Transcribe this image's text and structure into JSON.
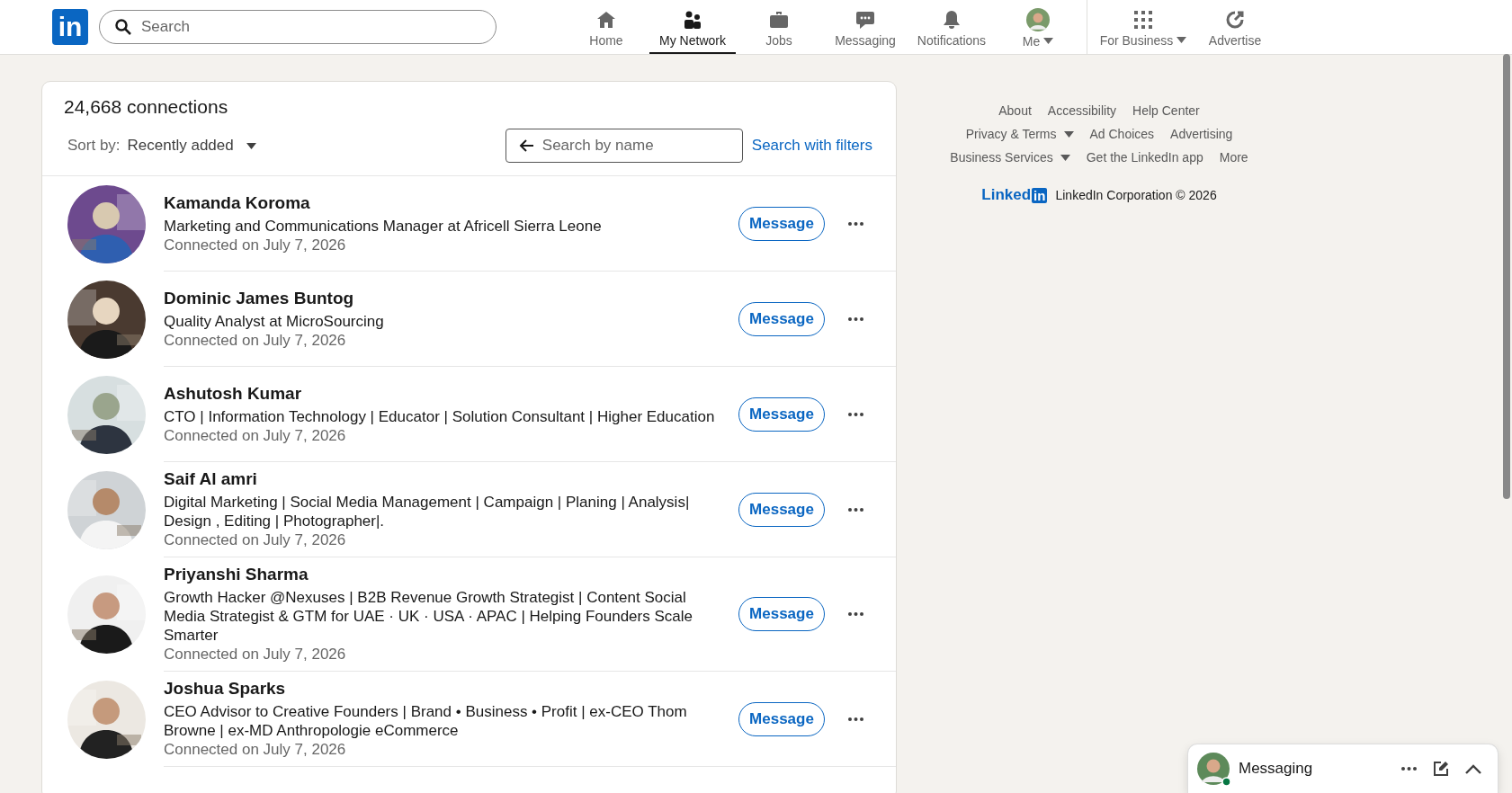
{
  "nav": {
    "logo": "in",
    "search": {
      "placeholder": "Search"
    },
    "items": [
      {
        "label": "Home",
        "kind": "home",
        "selected": false,
        "caret": false
      },
      {
        "label": "My Network",
        "kind": "network",
        "selected": true,
        "caret": false
      },
      {
        "label": "Jobs",
        "kind": "jobs",
        "selected": false,
        "caret": false
      },
      {
        "label": "Messaging",
        "kind": "messaging",
        "selected": false,
        "caret": false
      },
      {
        "label": "Notifications",
        "kind": "bell",
        "selected": false,
        "caret": false
      },
      {
        "label": "Me",
        "kind": "avatar",
        "selected": false,
        "caret": true
      }
    ],
    "extra": [
      {
        "label": "For Business",
        "kind": "grid",
        "caret": true
      },
      {
        "label": "Advertise",
        "kind": "advertise",
        "caret": false
      }
    ]
  },
  "connections": {
    "title": "24,668 connections",
    "sort_label": "Sort by:",
    "sort_value": "Recently added",
    "search": {
      "placeholder": "Search by name"
    },
    "filters_link": "Search with filters",
    "rows": [
      {
        "name": "Kamanda Koroma",
        "headline": "Marketing and Communications Manager at Africell Sierra Leone",
        "connected": "Connected on July 7, 2026",
        "kind": "picture",
        "button": "Message"
      },
      {
        "name": "Dominic James Buntog",
        "headline": "Quality Analyst at MicroSourcing",
        "connected": "Connected on July 7, 2026",
        "kind": "picture",
        "button": "Message"
      },
      {
        "name": "Ashutosh Kumar",
        "headline": "CTO | Information Technology | Educator | Solution Consultant | Higher Education",
        "connected": "Connected on July 7, 2026",
        "kind": "picture",
        "button": "Message"
      },
      {
        "name": "Saif Al amri",
        "headline": "Digital Marketing | Social Media Management | Campaign | Planing | Analysis| Design , Editing | Photographer|.",
        "connected": "Connected on July 7, 2026",
        "kind": "picture",
        "button": "Message"
      },
      {
        "name": "Priyanshi Sharma",
        "headline": "Growth Hacker @Nexuses | B2B Revenue Growth Strategist | Content Social Media Strategist & GTM for UAE · UK · USA · APAC | Helping Founders Scale Smarter",
        "connected": "Connected on July 7, 2026",
        "kind": "picture",
        "button": "Message"
      },
      {
        "name": "Joshua Sparks",
        "headline": "CEO Advisor to Creative Founders | Brand • Business • Profit | ex-CEO Thom Browne | ex-MD Anthropologie eCommerce",
        "connected": "Connected on July 7, 2026",
        "kind": "picture",
        "button": "Message"
      }
    ]
  },
  "footer": {
    "rows": [
      [
        {
          "label": "About",
          "caret": false
        },
        {
          "label": "Accessibility",
          "caret": false
        },
        {
          "label": "Help Center",
          "caret": false
        }
      ],
      [
        {
          "label": "Privacy & Terms",
          "caret": true
        },
        {
          "label": "Ad Choices",
          "caret": false
        },
        {
          "label": "Advertising",
          "caret": false
        }
      ],
      [
        {
          "label": "Business Services",
          "caret": true
        },
        {
          "label": "Get the LinkedIn app",
          "caret": false
        },
        {
          "label": "More",
          "caret": false
        }
      ]
    ],
    "logo_word": "Linked",
    "logo_box": "in",
    "copyright": "LinkedIn Corporation © 2026"
  },
  "messaging": {
    "title": "Messaging",
    "online": true
  }
}
